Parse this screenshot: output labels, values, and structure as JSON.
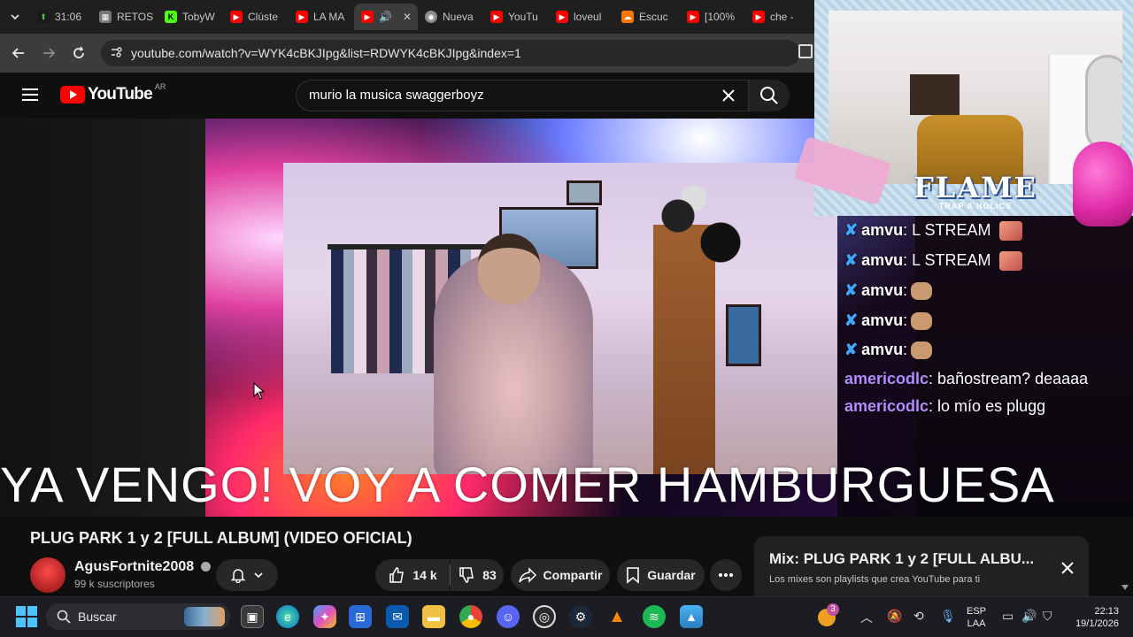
{
  "browser": {
    "tabs": [
      {
        "label": "31:06",
        "icon": "stream-icon"
      },
      {
        "label": "RETOS",
        "icon": "grid-icon"
      },
      {
        "label": "TobyW",
        "icon": "kick-icon"
      },
      {
        "label": "Clúste",
        "icon": "youtube-icon"
      },
      {
        "label": "LA MA",
        "icon": "youtube-icon"
      },
      {
        "label": "",
        "icon": "youtube-icon",
        "active": true
      },
      {
        "label": "Nueva",
        "icon": "chrome-icon"
      },
      {
        "label": "YouTu",
        "icon": "youtube-icon"
      },
      {
        "label": "loveul",
        "icon": "youtube-icon"
      },
      {
        "label": "Escuc",
        "icon": "soundcloud-icon"
      },
      {
        "label": "[100%",
        "icon": "youtube-icon"
      },
      {
        "label": "che -",
        "icon": "youtube-icon"
      }
    ],
    "url": "youtube.com/watch?v=WYK4cBKJIpg&list=RDWYK4cBKJIpg&index=1"
  },
  "youtube": {
    "logo_text": "YouTube",
    "region": "AR",
    "search_value": "murio la musica swaggerboyz"
  },
  "video": {
    "caption": "YA VENGO! VOY A COMER HAMBURGUESA",
    "chat": [
      {
        "user": "amvu",
        "message": ": L STREAM",
        "badge": true,
        "user_color": "#ffffff"
      },
      {
        "user": "amvu",
        "message": ": L STREAM",
        "badge": true,
        "user_color": "#ffffff"
      },
      {
        "user": "amvu",
        "message": ":",
        "badge": true,
        "user_color": "#ffffff",
        "emote": true
      },
      {
        "user": "amvu",
        "message": ":",
        "badge": true,
        "user_color": "#ffffff",
        "emote": true
      },
      {
        "user": "amvu",
        "message": ":",
        "badge": true,
        "user_color": "#ffffff",
        "emote": true
      },
      {
        "user": "americodlc",
        "message": ": bañostream? deaaaa",
        "badge": false,
        "user_color": "#b38cff"
      },
      {
        "user": "americodlc",
        "message": ": lo mío es plugg",
        "badge": false,
        "user_color": "#b38cff"
      }
    ],
    "overlay_brand": "FLAME",
    "overlay_sub": "TRAP A HOLICS"
  },
  "details": {
    "title": "PLUG PARK 1 y 2 [FULL ALBUM] (VIDEO OFICIAL)",
    "channel": "AgusFortnite2008",
    "subscribers": "99 k suscriptores",
    "likes": "14 k",
    "dislikes": "83",
    "share_label": "Compartir",
    "save_label": "Guardar"
  },
  "mix": {
    "title": "Mix: PLUG PARK 1 y 2 [FULL ALBU...",
    "subtitle": "Los mixes son playlists que crea YouTube para ti"
  },
  "taskbar": {
    "search_label": "Buscar",
    "notification_count": "3",
    "lang_top": "ESP",
    "lang_bottom": "LAA",
    "time": "22:13",
    "date": "19/1/2026"
  },
  "colors": {
    "youtube_red": "#ff0000",
    "accent_blue": "#3ea6ff",
    "chat_purple": "#b38cff"
  }
}
